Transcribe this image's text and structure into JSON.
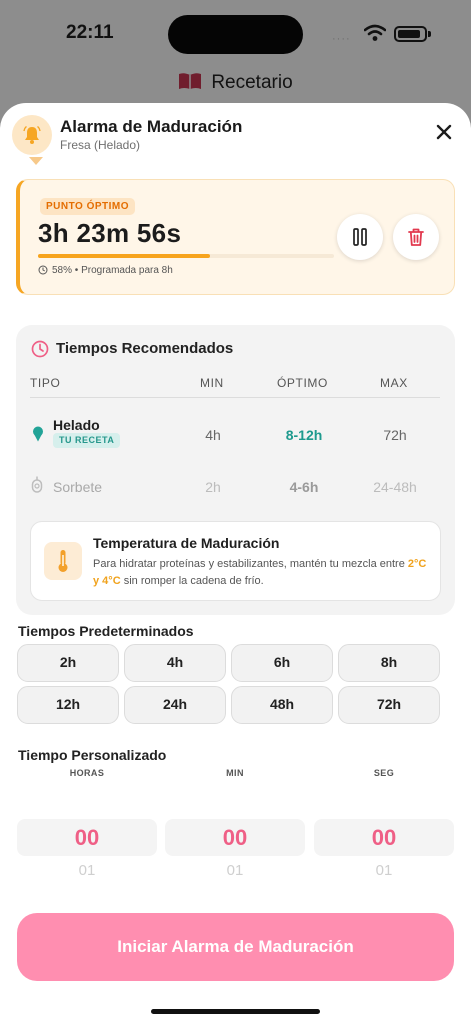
{
  "status_bar": {
    "time": "22:11",
    "signal": "····"
  },
  "background_nav": {
    "title": "Recetario"
  },
  "header": {
    "title": "Alarma de Maduración",
    "subtitle": "Fresa (Helado)"
  },
  "timer": {
    "badge": "PUNTO ÓPTIMO",
    "remaining": "3h 23m 56s",
    "progress_percent": 58,
    "meta": "58% • Programada para 8h"
  },
  "tiempos": {
    "title": "Tiempos Recomendados",
    "headers": [
      "TIPO",
      "MIN",
      "ÓPTIMO",
      "MAX"
    ],
    "rows": [
      {
        "name": "Helado",
        "tag": "TU RECETA",
        "min": "4h",
        "optimo": "8-12h",
        "max": "72h"
      },
      {
        "name": "Sorbete",
        "min": "2h",
        "optimo": "4-6h",
        "max": "24-48h"
      }
    ],
    "temperature": {
      "title": "Temperatura de Maduración",
      "body_1": "Para hidratar proteínas y estabilizantes, mantén tu mezcla entre ",
      "range": "2°C y 4°C",
      "body_2": " sin romper la cadena de frío."
    }
  },
  "presets": {
    "title": "Tiempos Predeterminados",
    "items": [
      "2h",
      "4h",
      "6h",
      "8h",
      "12h",
      "24h",
      "48h",
      "72h"
    ]
  },
  "custom": {
    "title": "Tiempo Personalizado",
    "columns": [
      {
        "label": "HORAS",
        "value": "00",
        "next": "01"
      },
      {
        "label": "MIN",
        "value": "00",
        "next": "01"
      },
      {
        "label": "SEG",
        "value": "00",
        "next": "01"
      }
    ]
  },
  "cta": {
    "label": "Iniciar Alarma de Maduración"
  },
  "colors": {
    "accent_orange": "#f6a623",
    "teal": "#1e9a8e",
    "pink": "#ef5f86",
    "cta": "#ff8eb0"
  },
  "icons": [
    "bell-icon",
    "close-icon",
    "clock-icon",
    "pause-icon",
    "trash-icon",
    "ice-cream-icon",
    "sorbet-icon",
    "thermometer-icon",
    "book-icon",
    "wifi-icon",
    "battery-icon"
  ]
}
